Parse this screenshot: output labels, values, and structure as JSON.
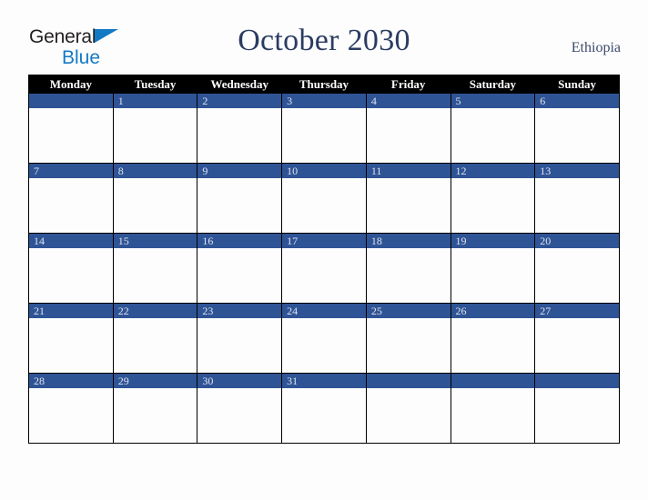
{
  "branding": {
    "logo_line1": "General",
    "logo_line2": "Blue",
    "logo_dark_color": "#231f20",
    "logo_blue_color": "#1479c4"
  },
  "header": {
    "title": "October 2030",
    "country": "Ethiopia",
    "title_color": "#2b3c63"
  },
  "calendar": {
    "month": "October",
    "year": "2030",
    "accent_color": "#2f5496",
    "header_bg_color": "#000000",
    "header_text_color": "#ffffff",
    "weekday_headers": [
      "Monday",
      "Tuesday",
      "Wednesday",
      "Thursday",
      "Friday",
      "Saturday",
      "Sunday"
    ],
    "weeks": [
      [
        "",
        "1",
        "2",
        "3",
        "4",
        "5",
        "6"
      ],
      [
        "7",
        "8",
        "9",
        "10",
        "11",
        "12",
        "13"
      ],
      [
        "14",
        "15",
        "16",
        "17",
        "18",
        "19",
        "20"
      ],
      [
        "21",
        "22",
        "23",
        "24",
        "25",
        "26",
        "27"
      ],
      [
        "28",
        "29",
        "30",
        "31",
        "",
        "",
        ""
      ]
    ]
  }
}
